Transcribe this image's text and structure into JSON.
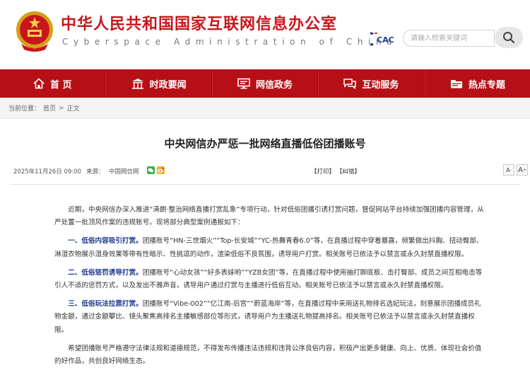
{
  "header": {
    "title": "中华人民共和国国家互联网信息办公室",
    "subtitle": "Cyberspace Administration of China",
    "search_placeholder": "请输入检索关键词"
  },
  "nav": [
    {
      "label": "首 页",
      "icon": "home-icon"
    },
    {
      "label": "时政要闻",
      "icon": "pavilion-icon"
    },
    {
      "label": "网信政务",
      "icon": "monitor-icon"
    },
    {
      "label": "互动服务",
      "icon": "chat-icon"
    },
    {
      "label": "热点专题",
      "icon": "folder-icon"
    }
  ],
  "breadcrumb": {
    "label": "当前位置：",
    "items": [
      "首页",
      "正文"
    ],
    "separator": ">"
  },
  "article": {
    "title": "中央网信办严惩一批网络直播低俗团播账号",
    "date": "2025年11月26日 09:00",
    "source_label": "来源：",
    "source": "中国网信网",
    "print": "【打印】",
    "correct": "【纠错】",
    "font_small": "A",
    "font_large": "A",
    "paragraphs": [
      {
        "lead": "",
        "text": "近期，中央网信办深入推进“清朗·整治网络直播打赏乱象”专项行动，针对低俗团播引诱打赏问题，督促网站平台持续加强团播内容管理，从严处置一批顶风作案的违规账号。现将部分典型案例通报如下："
      },
      {
        "lead": "一、低俗内容吸引打赏。",
        "text": "团播账号“HN-三世烟火”“Top-长安城”“YC-热舞青春6.0”等，在直播过程中穿着暴露，频繁做出抖胸、扭动臀部、淋湿衣物展示湿身效果等带有性暗示、性挑逗的动作，渲染低俗不良氛围，诱导用户打赏。相关账号已依法予以禁言或永久封禁直播权限。"
      },
      {
        "lead": "二、低俗惩罚诱导打赏。",
        "text": "团播账号“心动女孩”“好多表妹哟”“YZB女团”等，在直播过程中使用抽打脚底板、击打臀部、成员之间互相电击等引人不适的惩罚方式，以及发出不雅声音，诱导用户通过打赏与主播进行低俗互动。相关账号已依法予以禁言或永久封禁直播权限。"
      },
      {
        "lead": "三、低俗玩法拉票打赏。",
        "text": "团播账号“Vibe-002”“亿江南-后宫”“蔚蓝海岸”等，在直播过程中采用送礼物排名选妃玩法，刻意展示团播成员礼物金额，通过金额攀比、镜头聚焦高排名主播敏感部位等形式，诱导用户为主播送礼物提高排名。相关账号已依法予以禁言或永久封禁直播权限。"
      },
      {
        "lead": "",
        "text": "希望团播账号严格遵守法律法规和道德规范，不得发布传播违法违规和违背公序良俗内容，积极产出更多健康、向上、优质、体现社会价值的好作品，共创良好网络生态。"
      }
    ]
  },
  "colors": {
    "brand_red": "#b61016",
    "title_red": "#c8161d",
    "highlight_blue": "#1c3a8f"
  }
}
